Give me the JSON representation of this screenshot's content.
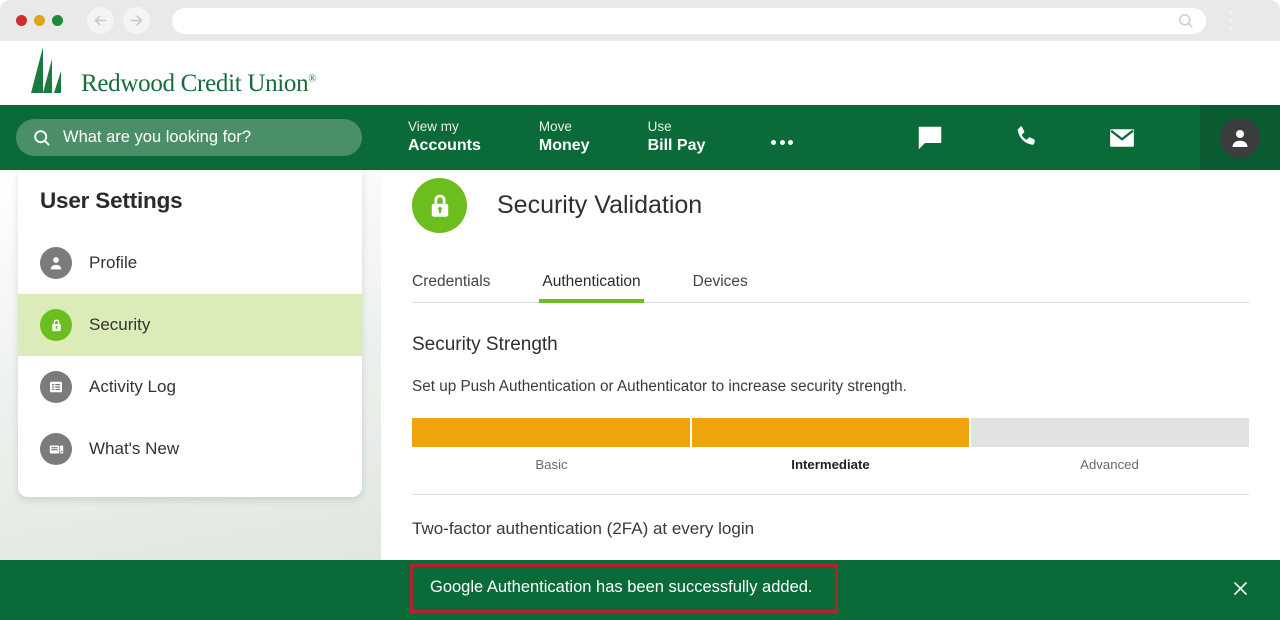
{
  "browser": {
    "back_icon": "arrow-left-icon",
    "forward_icon": "arrow-right-icon",
    "url_value": "",
    "url_search_icon": "search-icon",
    "menu_icon": "kebab-menu-icon",
    "traffic_lights": [
      "close-red",
      "minimize-yellow",
      "maximize-green"
    ]
  },
  "brand": {
    "name": "Redwood Credit Union",
    "trademark": "®",
    "logo_icon": "redwood-tree-logo",
    "color": "#186b3a"
  },
  "nav": {
    "search_placeholder": "What are you looking for?",
    "search_icon": "search-icon",
    "links": [
      {
        "top": "View my",
        "bottom": "Accounts"
      },
      {
        "top": "Move",
        "bottom": "Money"
      },
      {
        "top": "Use",
        "bottom": "Bill Pay"
      }
    ],
    "more_icon": "ellipsis-icon",
    "icons": [
      "chat-bubble-icon",
      "phone-icon",
      "mail-icon"
    ],
    "avatar_icon": "user-avatar-icon",
    "bar_color": "#0a6b38",
    "avatar_cell_color": "#0a5b30"
  },
  "sidebar": {
    "title": "User Settings",
    "items": [
      {
        "label": "Profile",
        "icon": "person-icon",
        "active": false
      },
      {
        "label": "Security",
        "icon": "lock-icon",
        "active": true
      },
      {
        "label": "Activity Log",
        "icon": "list-icon",
        "active": false
      },
      {
        "label": "What's New",
        "icon": "device-news-icon",
        "active": false
      }
    ],
    "active_bg": "#dcecb8"
  },
  "main": {
    "page_icon": "lock-badge-icon",
    "page_title": "Security Validation",
    "tabs": [
      {
        "label": "Credentials",
        "active": false
      },
      {
        "label": "Authentication",
        "active": true
      },
      {
        "label": "Devices",
        "active": false
      }
    ],
    "section_title": "Security Strength",
    "section_subtitle": "Set up Push Authentication or Authenticator to increase security strength.",
    "strength": {
      "levels": [
        "Basic",
        "Intermediate",
        "Advanced"
      ],
      "filled": [
        true,
        true,
        false
      ],
      "current": "Intermediate",
      "fill_color": "#efa30d",
      "empty_color": "#e2e2e2"
    },
    "two_factor_heading": "Two-factor authentication (2FA) at every login"
  },
  "toast": {
    "message": "Google Authentication has been successfully added.",
    "close_icon": "close-icon",
    "background": "#0a6b38",
    "highlight_border": "#b3232b"
  }
}
